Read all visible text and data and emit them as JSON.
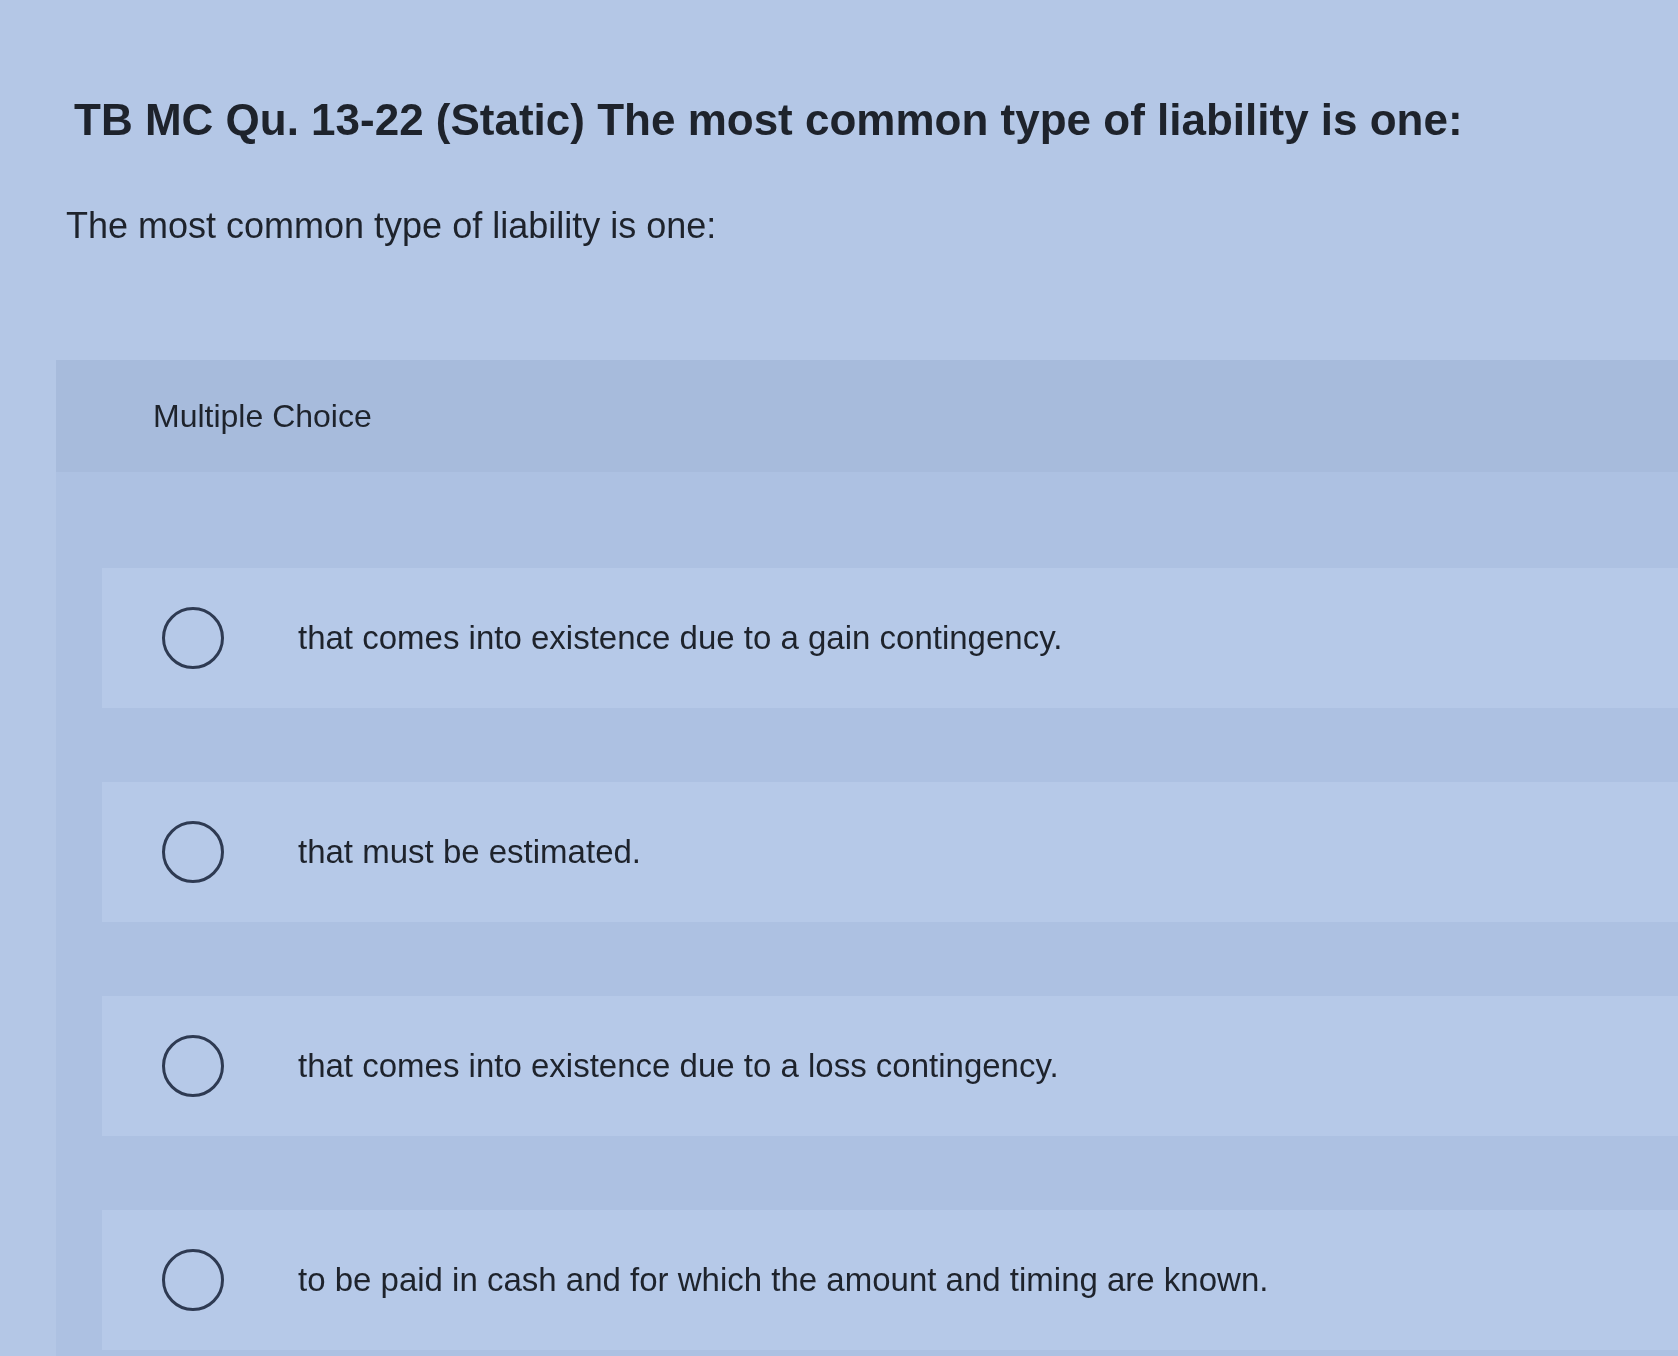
{
  "title": "TB MC Qu. 13-22 (Static) The most common type of liability is one:",
  "question": "The most common type of liability is one:",
  "answer_panel": {
    "label": "Multiple Choice",
    "options": [
      {
        "text": "that comes into existence due to a gain contingency.",
        "selected": false
      },
      {
        "text": "that must be estimated.",
        "selected": false
      },
      {
        "text": "that comes into existence due to a loss contingency.",
        "selected": false
      },
      {
        "text": "to be paid in cash and for which the amount and timing are known.",
        "selected": false
      }
    ]
  }
}
